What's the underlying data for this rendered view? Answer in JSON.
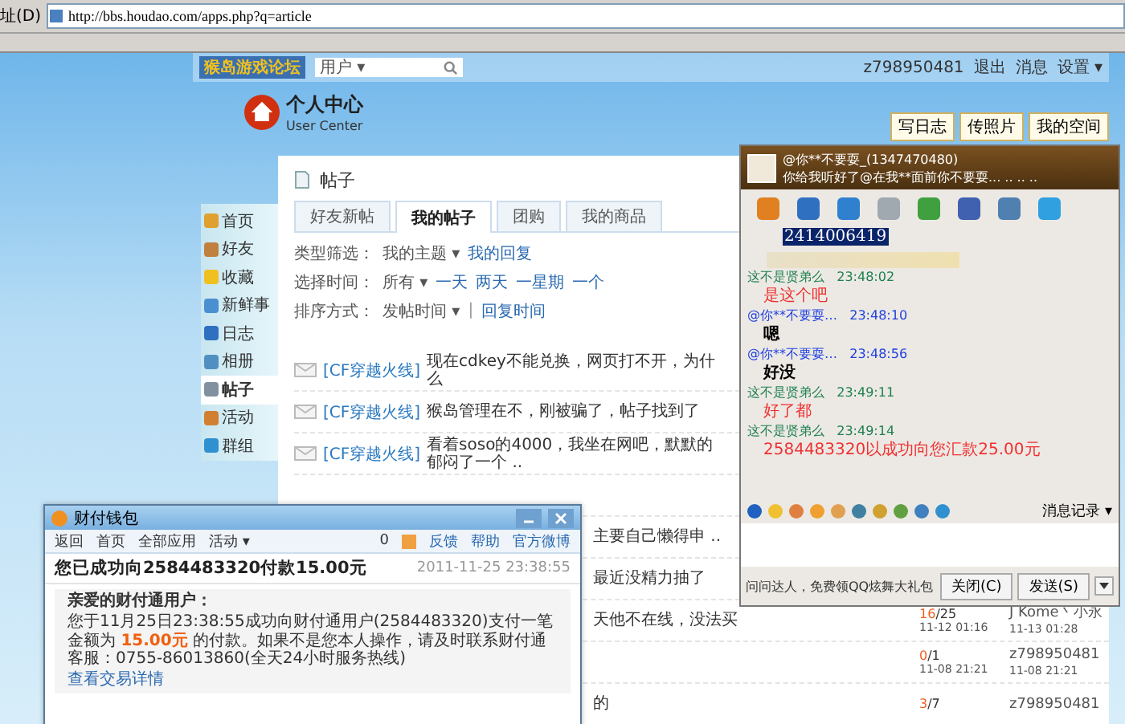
{
  "browser": {
    "address_label": "址(D)",
    "url": "http://bbs.houdao.com/apps.php?q=article"
  },
  "site": {
    "logo": "猴岛游戏论坛",
    "search_scope": "用户 ▾",
    "username": "z798950481",
    "links": [
      "退出",
      "消息",
      "设置 ▾"
    ]
  },
  "header": {
    "title": "个人中心",
    "subtitle": "User Center",
    "buttons": [
      "写日志",
      "传照片",
      "我的空间"
    ]
  },
  "sidebar": {
    "items": [
      {
        "label": "首页",
        "selected": false
      },
      {
        "label": "好友",
        "selected": false
      },
      {
        "label": "收藏",
        "selected": false
      },
      {
        "label": "新鲜事",
        "selected": false
      },
      {
        "label": "日志",
        "selected": false
      },
      {
        "label": "相册",
        "selected": false
      },
      {
        "label": "帖子",
        "selected": true
      },
      {
        "label": "活动",
        "selected": false
      },
      {
        "label": "群组",
        "selected": false
      }
    ]
  },
  "main": {
    "title": "帖子",
    "tabs": [
      {
        "label": "好友新帖",
        "selected": false
      },
      {
        "label": "我的帖子",
        "selected": true
      },
      {
        "label": "团购",
        "selected": false
      },
      {
        "label": "我的商品",
        "selected": false
      }
    ],
    "type_filter": {
      "label": "类型筛选：",
      "value": "我的主题 ▾",
      "other": "我的回复"
    },
    "time_filter": {
      "label": "选择时间：",
      "value": "所有 ▾",
      "options": [
        "一天",
        "两天",
        "一星期",
        "一个"
      ]
    },
    "sort": {
      "label": "排序方式：",
      "value": "发帖时间 ▾",
      "separator": "|",
      "other": "回复时间"
    },
    "posts": [
      {
        "kind": "full",
        "tag": "[CF穿越火线]",
        "title": "现在cdkey不能兑换，网页打不开，为什么"
      },
      {
        "kind": "full",
        "tag": "[CF穿越火线]",
        "title": "猴岛管理在不，刚被骗了，帖子找到了"
      },
      {
        "kind": "full",
        "tag": "[CF穿越火线]",
        "title": "看着soso的4000，我坐在网吧，默默的郁闷了一个 .."
      },
      {
        "kind": "hidden"
      },
      {
        "kind": "tail",
        "title": "主要自己懒得申 .."
      },
      {
        "kind": "tail",
        "title": "最近没精力抽了"
      },
      {
        "kind": "tail",
        "title": "天他不在线，没法买",
        "replies": "16",
        "views": "/25",
        "reply_time": "11-12 01:16",
        "last_user": "J Kome丶小永",
        "last_time": "11-13 01:28"
      },
      {
        "kind": "stats",
        "replies": "0",
        "views": "/1",
        "reply_time": "11-08 21:21",
        "last_user": "z798950481",
        "last_time": "11-08 21:21"
      },
      {
        "kind": "tail",
        "title": "的",
        "replies": "3",
        "views": "/7",
        "last_user": "z798950481"
      }
    ]
  },
  "chat": {
    "name": "@你**不要耍_(1347470480)",
    "status": "你给我听好了@在我**面前你不要耍... .. .. ..",
    "selected_text": "2414006419",
    "messages": [
      {
        "sender": "这不是贤弟么",
        "time": "23:48:02",
        "kind": "sent",
        "text": "是这个吧"
      },
      {
        "sender": "@你**不要耍…",
        "time": "23:48:10",
        "kind": "received",
        "text": "嗯"
      },
      {
        "sender": "@你**不要耍…",
        "time": "23:48:56",
        "kind": "received",
        "text": "好没"
      },
      {
        "sender": "这不是贤弟么",
        "time": "23:49:11",
        "kind": "sent",
        "text": "好了都"
      },
      {
        "sender": "这不是贤弟么",
        "time": "23:49:14",
        "kind": "sent",
        "text": "2584483320以成功向您汇款25.00元"
      }
    ],
    "history_button": "消息记录 ▾",
    "ad": "问问达人，免费领QQ炫舞大礼包",
    "close_button": "关闭(C)",
    "send_button": "发送(S)"
  },
  "wallet": {
    "title": "财付钱包",
    "nav": [
      "返回",
      "首页",
      "全部应用",
      "活动 ▾"
    ],
    "coin_count": "0",
    "links": [
      "反馈",
      "帮助",
      "官方微博"
    ],
    "subject": "您已成功向2584483320付款15.00元",
    "date": "2011-11-25 23:38:55",
    "greeting": "亲爱的财付通用户：",
    "body": "您于11月25日23:38:55成功向财付通用户(2584483320)支付一笔金额为 **15.00元** 的付款。如果不是您本人操作，请及时联系财付通客服：0755-86013860(全天24小时服务热线)",
    "details_link": "查看交易详情"
  }
}
